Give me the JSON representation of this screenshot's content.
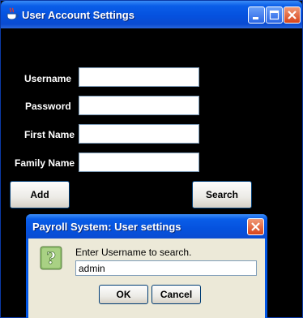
{
  "window": {
    "title": "User Account Settings",
    "app_icon": "java-coffee-cup-icon",
    "controls": [
      "minimize-icon",
      "maximize-icon",
      "close-icon"
    ]
  },
  "form": {
    "username_label": "Username",
    "password_label": "Password",
    "first_name_label": "First Name",
    "family_name_label": "Family Name",
    "username_value": "",
    "password_value": "",
    "first_name_value": "",
    "family_name_value": "",
    "add_label": "Add",
    "search_label": "Search"
  },
  "dialog": {
    "title": "Payroll System: User settings",
    "icon": "question-icon",
    "message": "Enter Username to search.",
    "input_value": "admin",
    "ok_label": "OK",
    "cancel_label": "Cancel"
  },
  "colors": {
    "titlebar": "#0551de",
    "background": "#000000",
    "dialog_body": "#ece9d8",
    "close_button": "#d8441a"
  }
}
